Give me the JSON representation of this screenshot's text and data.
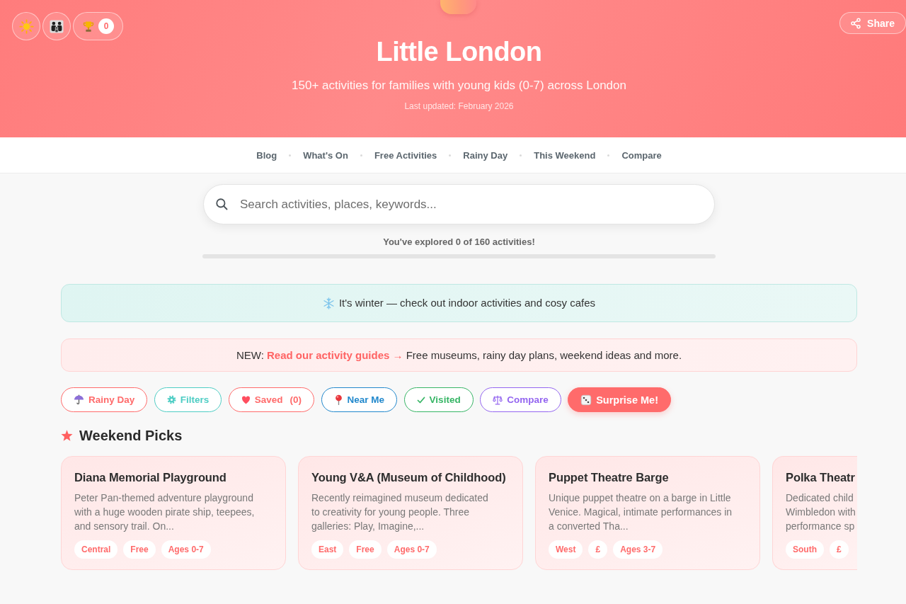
{
  "header": {
    "title": "Little London",
    "subtitle": "150+ activities for families with young kids (0-7) across London",
    "updated": "Last updated: February 2026",
    "achievements_count": "0",
    "share_label": "Share"
  },
  "nav": [
    "Blog",
    "What's On",
    "Free Activities",
    "Rainy Day",
    "This Weekend",
    "Compare"
  ],
  "search": {
    "placeholder": "Search activities, places, keywords..."
  },
  "progress": {
    "text": "You've explored 0 of 160 activities!",
    "level": 0
  },
  "season_banner": {
    "text": "It's winter — check out indoor activities and cosy cafes"
  },
  "news_banner": {
    "lead": "NEW:",
    "link": "Read our activity guides →",
    "text": "Free museums, rainy day plans, weekend ideas and more."
  },
  "filters": [
    {
      "label": "Rainy Day",
      "kind": "outline",
      "color": "#ff6b6b"
    },
    {
      "label": "Filters",
      "kind": "outline",
      "color": "#4ecdc4"
    },
    {
      "label": "Saved",
      "count": "(0)",
      "kind": "outline",
      "color": "#ff6b6b"
    },
    {
      "label": "Near Me",
      "kind": "outline",
      "color": "#2188cc"
    },
    {
      "label": "Visited",
      "kind": "outline",
      "color": "#36b565"
    },
    {
      "label": "Compare",
      "kind": "outline",
      "color": "#9466f0"
    },
    {
      "label": "Surprise Me!",
      "kind": "filled",
      "color": "#ff6b6b"
    }
  ],
  "weekend_picks": {
    "title": "Weekend Picks",
    "cards": [
      {
        "title": "Diana Memorial Playground",
        "description": "Peter Pan-themed adventure playground\nwith a huge wooden pirate ship, teepees,\nand sensory trail. On...",
        "tags": [
          "Central",
          "Free",
          "Ages 0-7"
        ]
      },
      {
        "title": "Young V&A (Museum of Childhood)",
        "description": "Recently reimagined museum dedicated\nto creativity for young people. Three\ngalleries: Play, Imagine,...",
        "tags": [
          "East",
          "Free",
          "Ages 0-7"
        ]
      },
      {
        "title": "Puppet Theatre Barge",
        "description": "Unique puppet theatre on a barge in Little\nVenice. Magical, intimate performances in\na converted Tha...",
        "tags": [
          "West",
          "£",
          "Ages 3-7"
        ]
      },
      {
        "title": "Polka Theatr",
        "description": "Dedicated child\nWimbledon with\nperformance sp",
        "tags": [
          "South",
          "£"
        ]
      }
    ]
  }
}
